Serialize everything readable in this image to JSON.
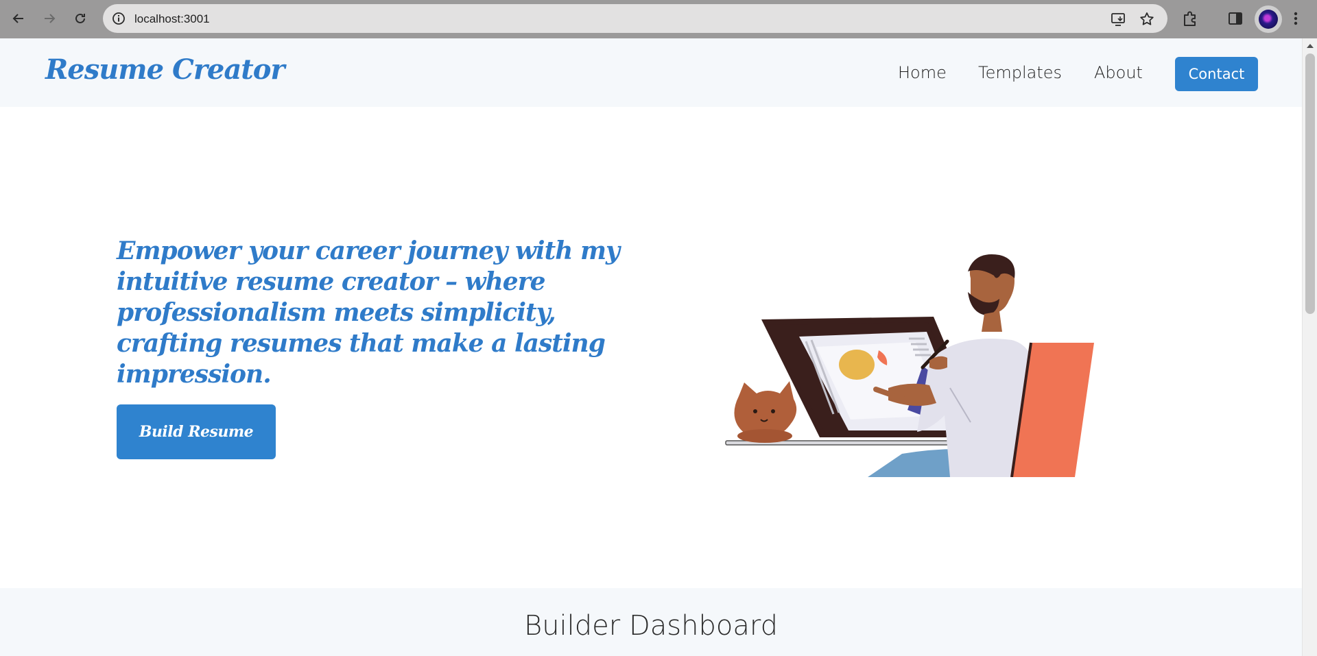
{
  "browser": {
    "url": "localhost:3001",
    "back_icon": "arrow-left-icon",
    "forward_icon": "arrow-right-icon",
    "reload_icon": "reload-icon",
    "info_icon": "info-icon",
    "install_icon": "install-app-icon",
    "bookmark_icon": "star-icon",
    "extensions_icon": "puzzle-icon",
    "sidepanel_icon": "side-panel-icon",
    "menu_icon": "kebab-menu-icon"
  },
  "site": {
    "logo": "Resume Creator",
    "nav": {
      "home": "Home",
      "templates": "Templates",
      "about": "About",
      "contact": "Contact"
    },
    "hero": {
      "headline": "Empower your career journey with my intuitive resume creator – where professionalism meets simplicity, crafting resumes that make a lasting impression.",
      "cta": "Build Resume"
    },
    "dashboard": {
      "title": "Builder Dashboard"
    }
  },
  "colors": {
    "accent": "#2f83cf",
    "logo_text": "#2f7bc9",
    "header_bg": "#f5f8fb",
    "chair": "#f07454"
  }
}
